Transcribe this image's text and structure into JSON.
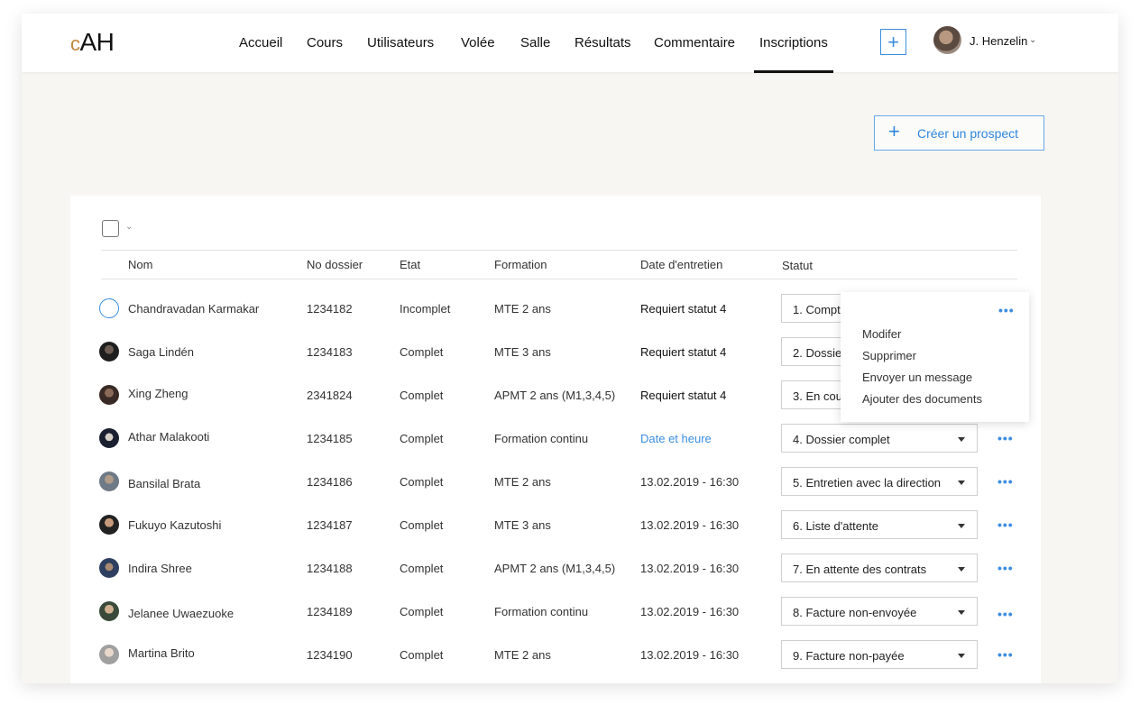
{
  "logo": {
    "c": "c",
    "rest": "AH"
  },
  "nav": [
    "Accueil",
    "Cours",
    "Utilisateurs",
    "Volée",
    "Salle",
    "Résultats",
    "Commentaire",
    "Inscriptions"
  ],
  "nav_active": "Inscriptions",
  "header": {
    "plus": "+",
    "user_name": "J. Henzelin",
    "chevron": "⌄"
  },
  "create_button": {
    "icon": "+",
    "label": "Créer un prospect"
  },
  "table": {
    "columns": [
      "Nom",
      "No dossier",
      "Etat",
      "Formation",
      "Date d'entretien",
      "Statut"
    ],
    "rows": [
      {
        "name": "Chandravadan Karmakar",
        "dossier": "1234182",
        "etat": "Incomplet",
        "formation": "MTE 2 ans",
        "date": "Requiert statut 4",
        "date_style": "strong",
        "statut": "1. Compte"
      },
      {
        "name": "Saga Lindén",
        "dossier": "1234183",
        "etat": "Complet",
        "formation": "MTE 3 ans",
        "date": "Requiert statut 4",
        "date_style": "strong",
        "statut": "2. Dossier"
      },
      {
        "name": "Xing Zheng",
        "dossier": "2341824",
        "etat": "Complet",
        "formation": "APMT 2 ans (M1,3,4,5)",
        "date": "Requiert statut 4",
        "date_style": "strong",
        "statut": "3. En cours"
      },
      {
        "name": "Athar Malakooti",
        "dossier": "1234185",
        "etat": "Complet",
        "formation": "Formation continu",
        "date": "Date et heure",
        "date_style": "link",
        "statut": "4. Dossier complet"
      },
      {
        "name": "Bansilal Brata",
        "dossier": "1234186",
        "etat": "Complet",
        "formation": "MTE 2 ans",
        "date": "13.02.2019  - 16:30",
        "date_style": "plain",
        "statut": "5. Entretien avec la direction"
      },
      {
        "name": "Fukuyo Kazutoshi",
        "dossier": "1234187",
        "etat": "Complet",
        "formation": "MTE 3 ans",
        "date": "13.02.2019  - 16:30",
        "date_style": "plain",
        "statut": "6. Liste d'attente"
      },
      {
        "name": "Indira Shree",
        "dossier": "1234188",
        "etat": "Complet",
        "formation": "APMT 2 ans (M1,3,4,5)",
        "date": "13.02.2019  - 16:30",
        "date_style": "plain",
        "statut": "7. En attente des contrats"
      },
      {
        "name": "Jelanee Uwaezuoke",
        "dossier": "1234189",
        "etat": "Complet",
        "formation": "Formation continu",
        "date": "13.02.2019  - 16:30",
        "date_style": "plain",
        "statut": "8. Facture non-envoyée"
      },
      {
        "name": "Martina Brito",
        "dossier": "1234190",
        "etat": "Complet",
        "formation": "MTE 2 ans",
        "date": "13.02.2019  - 16:30",
        "date_style": "plain",
        "statut": "9. Facture non-payée"
      }
    ]
  },
  "more_dots": "•••",
  "context_menu": [
    "Modifer",
    "Supprimer",
    "Envoyer un message",
    "Ajouter des documents"
  ],
  "colors": {
    "accent": "#3b8de0",
    "logo_c": "#c0883f",
    "background": "#f7f6f2"
  }
}
